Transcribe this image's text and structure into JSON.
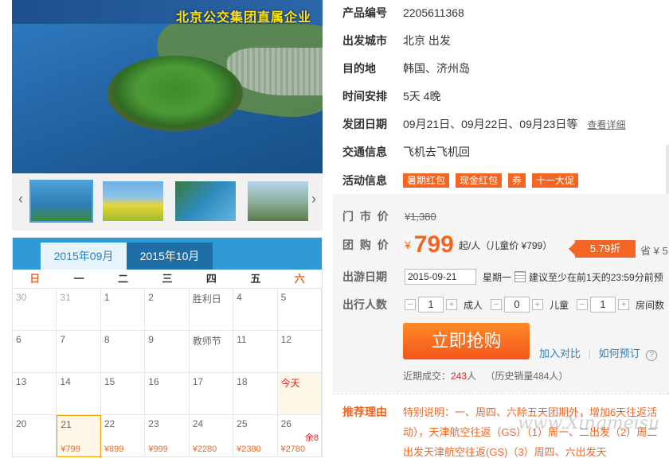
{
  "hero": {
    "banner_text": "北京公交集团直属企业"
  },
  "gallery": {
    "thumbnails": [
      "thumb-1",
      "thumb-2",
      "thumb-3",
      "thumb-4"
    ],
    "prev_icon": "‹",
    "next_icon": "›"
  },
  "calendar": {
    "tabs": [
      "2015年09月",
      "2015年10月"
    ],
    "weekdays": [
      "日",
      "一",
      "二",
      "三",
      "四",
      "五",
      "六"
    ],
    "rows": [
      [
        {
          "d": "30",
          "dim": true
        },
        {
          "d": "31",
          "dim": true
        },
        {
          "d": "1"
        },
        {
          "d": "2"
        },
        {
          "d": "胜利日"
        },
        {
          "d": "4"
        },
        {
          "d": "5"
        }
      ],
      [
        {
          "d": "6"
        },
        {
          "d": "7"
        },
        {
          "d": "8"
        },
        {
          "d": "9"
        },
        {
          "d": "教师节"
        },
        {
          "d": "11"
        },
        {
          "d": "12"
        }
      ],
      [
        {
          "d": "13"
        },
        {
          "d": "14"
        },
        {
          "d": "15"
        },
        {
          "d": "16"
        },
        {
          "d": "17"
        },
        {
          "d": "18"
        },
        {
          "d": "今天",
          "today": true
        }
      ],
      [
        {
          "d": "20"
        },
        {
          "d": "21",
          "price": "¥799",
          "sel": true
        },
        {
          "d": "22",
          "price": "¥899"
        },
        {
          "d": "23",
          "price": "¥999"
        },
        {
          "d": "24",
          "price": "¥2280"
        },
        {
          "d": "25",
          "price": "¥2380"
        },
        {
          "d": "26",
          "price": "¥2780",
          "rem": "余8"
        }
      ]
    ]
  },
  "info": {
    "product_no": {
      "label": "产品编号",
      "value": "2205611368"
    },
    "depart_city": {
      "label": "出发城市",
      "value": "北京 出发"
    },
    "destination": {
      "label": "目的地",
      "value": "韩国、济州岛"
    },
    "schedule": {
      "label": "时间安排",
      "value": "5天 4晚"
    },
    "dates": {
      "label": "发团日期",
      "value": "09月21日、09月22日、09月23日等",
      "link": "查看详细"
    },
    "transport": {
      "label": "交通信息",
      "value": "飞机去飞机回"
    },
    "activity": {
      "label": "活动信息",
      "tags": [
        "暑期红包",
        "现金红包",
        "券",
        "十一大促"
      ]
    }
  },
  "pricing": {
    "market_label": "门 市 价",
    "market_price": "¥1,380",
    "group_label": "团 购 价",
    "yen": "¥",
    "group_price": "799",
    "unit": "起/人（儿童价 ¥799）",
    "discount": "5.79折",
    "save": "省 ¥ 5",
    "date_label": "出游日期",
    "date_value": "2015-09-21",
    "weekday": "星期一",
    "date_hint": "建议至少在前1天的23:59分前预",
    "people_label": "出行人数",
    "adult": {
      "value": "1",
      "label": "成人"
    },
    "child": {
      "value": "0",
      "label": "儿童"
    },
    "rooms": {
      "value": "1",
      "label": "房间数"
    },
    "buy_label": "立即抢购",
    "compare_link": "加入对比",
    "how_link": "如何预订",
    "recent_label": "近期成交：",
    "recent_count": "243",
    "recent_unit": "人",
    "history": "（历史销量484人）"
  },
  "recommend": {
    "label": "推荐理由",
    "text": "特别说明：一、周四、六除五天团期外，增加6天往返活动），天津航空往返（GS）（1）周一、二出发（2）周二出发天津航空往返(GS)（3）周四、六出发天"
  },
  "watermark": "www.Xingmeisu"
}
